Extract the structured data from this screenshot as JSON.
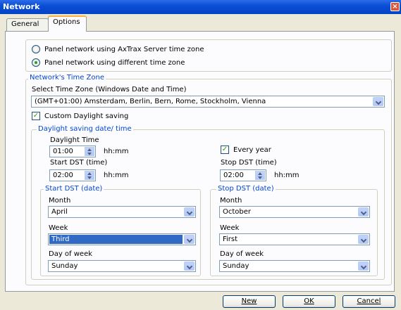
{
  "window": {
    "title": "Network",
    "close_glyph": "×"
  },
  "tabs": [
    {
      "label": "General",
      "active": false
    },
    {
      "label": "Options",
      "active": true
    }
  ],
  "network_mode": {
    "option_server": "Panel network using AxTrax Server time zone",
    "option_different": "Panel network using different time zone",
    "selected": "option_different"
  },
  "timezone_group": {
    "legend": "Network's Time Zone",
    "select_label": "Select Time Zone (Windows Date and Time)",
    "selected_zone": "(GMT+01:00) Amsterdam, Berlin, Bern, Rome, Stockholm, Vienna",
    "custom_dst_label": "Custom Daylight saving",
    "custom_dst_checked": true
  },
  "dst_group": {
    "legend": "Daylight saving date/ time",
    "daylight_time_label": "Daylight Time",
    "daylight_time_value": "01:00",
    "unit": "hh:mm",
    "every_year_label": "Every year",
    "every_year_checked": true,
    "start_time_label": "Start DST (time)",
    "start_time_value": "02:00",
    "stop_time_label": "Stop DST (time)",
    "stop_time_value": "02:00"
  },
  "start_date": {
    "legend": "Start DST (date)",
    "month_label": "Month",
    "month_value": "April",
    "week_label": "Week",
    "week_value": "Third",
    "dow_label": "Day of week",
    "dow_value": "Sunday"
  },
  "stop_date": {
    "legend": "Stop DST (date)",
    "month_label": "Month",
    "month_value": "October",
    "week_label": "Week",
    "week_value": "First",
    "dow_label": "Day of week",
    "dow_value": "Sunday"
  },
  "buttons": {
    "new_label": "New",
    "ok_label": "OK",
    "cancel_label": "Cancel"
  },
  "colors": {
    "accent": "#0046d5",
    "titlebar": "#0a4fd7",
    "selection": "#316ac5",
    "check": "#21a121"
  }
}
